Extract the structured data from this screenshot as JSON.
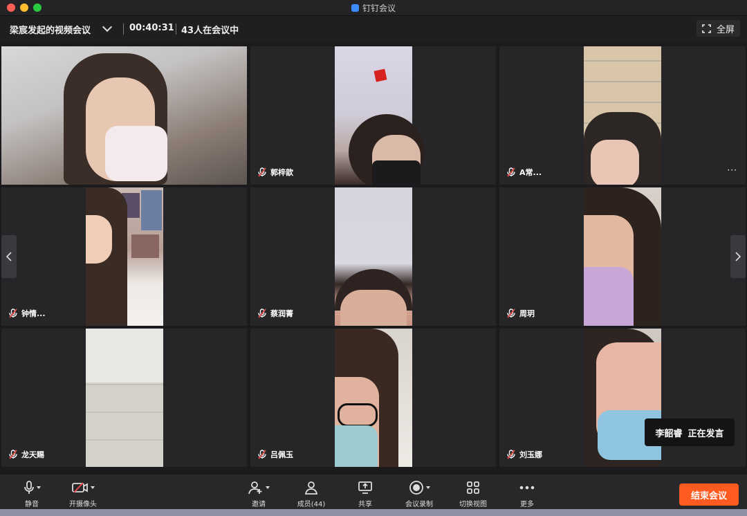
{
  "window": {
    "title": "钉钉会议"
  },
  "meeting": {
    "name": "梁宸发起的视频会议",
    "duration": "00:40:31",
    "participants_text": "43人在会议中",
    "fullscreen_label": "全屏"
  },
  "participants": [
    {
      "name": "",
      "muted": false
    },
    {
      "name": "郭梓歆",
      "muted": true
    },
    {
      "name": "A常...",
      "muted": true,
      "more": "···"
    },
    {
      "name": "钟情...",
      "muted": true
    },
    {
      "name": "蔡润菁",
      "muted": true
    },
    {
      "name": "周玥",
      "muted": true
    },
    {
      "name": "龙天赐",
      "muted": true
    },
    {
      "name": "吕佩玉",
      "muted": true
    },
    {
      "name": "刘玉娜",
      "muted": true
    }
  ],
  "speaker": {
    "name": "李韶睿",
    "status": "正在发言"
  },
  "toolbar": {
    "mute": "静音",
    "camera": "开摄像头",
    "invite": "邀请",
    "members": "成员(44)",
    "share": "共享",
    "record": "会议录制",
    "view": "切换视图",
    "more": "更多",
    "end": "结束会议"
  },
  "colors": {
    "end_button": "#ff5a1f",
    "muted_icon": "#e64a4a",
    "accent": "#3d8bff"
  }
}
